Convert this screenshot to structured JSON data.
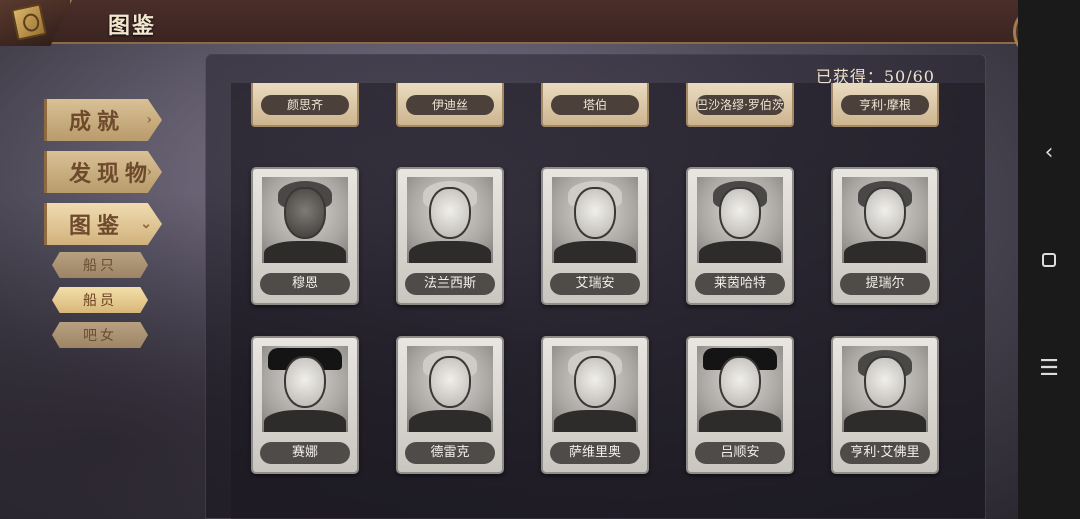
{
  "header": {
    "title": "图鉴",
    "book_icon": "book-icon",
    "back_icon": "undo-arrow-icon"
  },
  "system_nav": {
    "back_glyph": "‹",
    "menu_glyph": "☰"
  },
  "menu": {
    "tabs": [
      {
        "label": "成就",
        "active": false
      },
      {
        "label": "发现物",
        "active": false
      },
      {
        "label": "图鉴",
        "active": true
      }
    ],
    "sub_tabs": [
      {
        "label": "船只",
        "active": false
      },
      {
        "label": "船员",
        "active": true
      },
      {
        "label": "吧女",
        "active": false
      }
    ]
  },
  "collection": {
    "collected_label": "已获得：50/60",
    "top_row": [
      "颜思齐",
      "伊迪丝",
      "塔伯",
      "巴沙洛缪·罗伯茨",
      "亨利·摩根"
    ],
    "row1": [
      "穆恩",
      "法兰西斯",
      "艾瑞安",
      "莱茵哈特",
      "提瑞尔"
    ],
    "row2": [
      "赛娜",
      "德雷克",
      "萨维里奥",
      "吕顺安",
      "亨利·艾佛里"
    ]
  },
  "colors": {
    "tab_active": "#f0dcb0",
    "tab_inactive": "#d9c196",
    "crew_active": "#f3dfab",
    "name_plate": "#4e4b49"
  }
}
